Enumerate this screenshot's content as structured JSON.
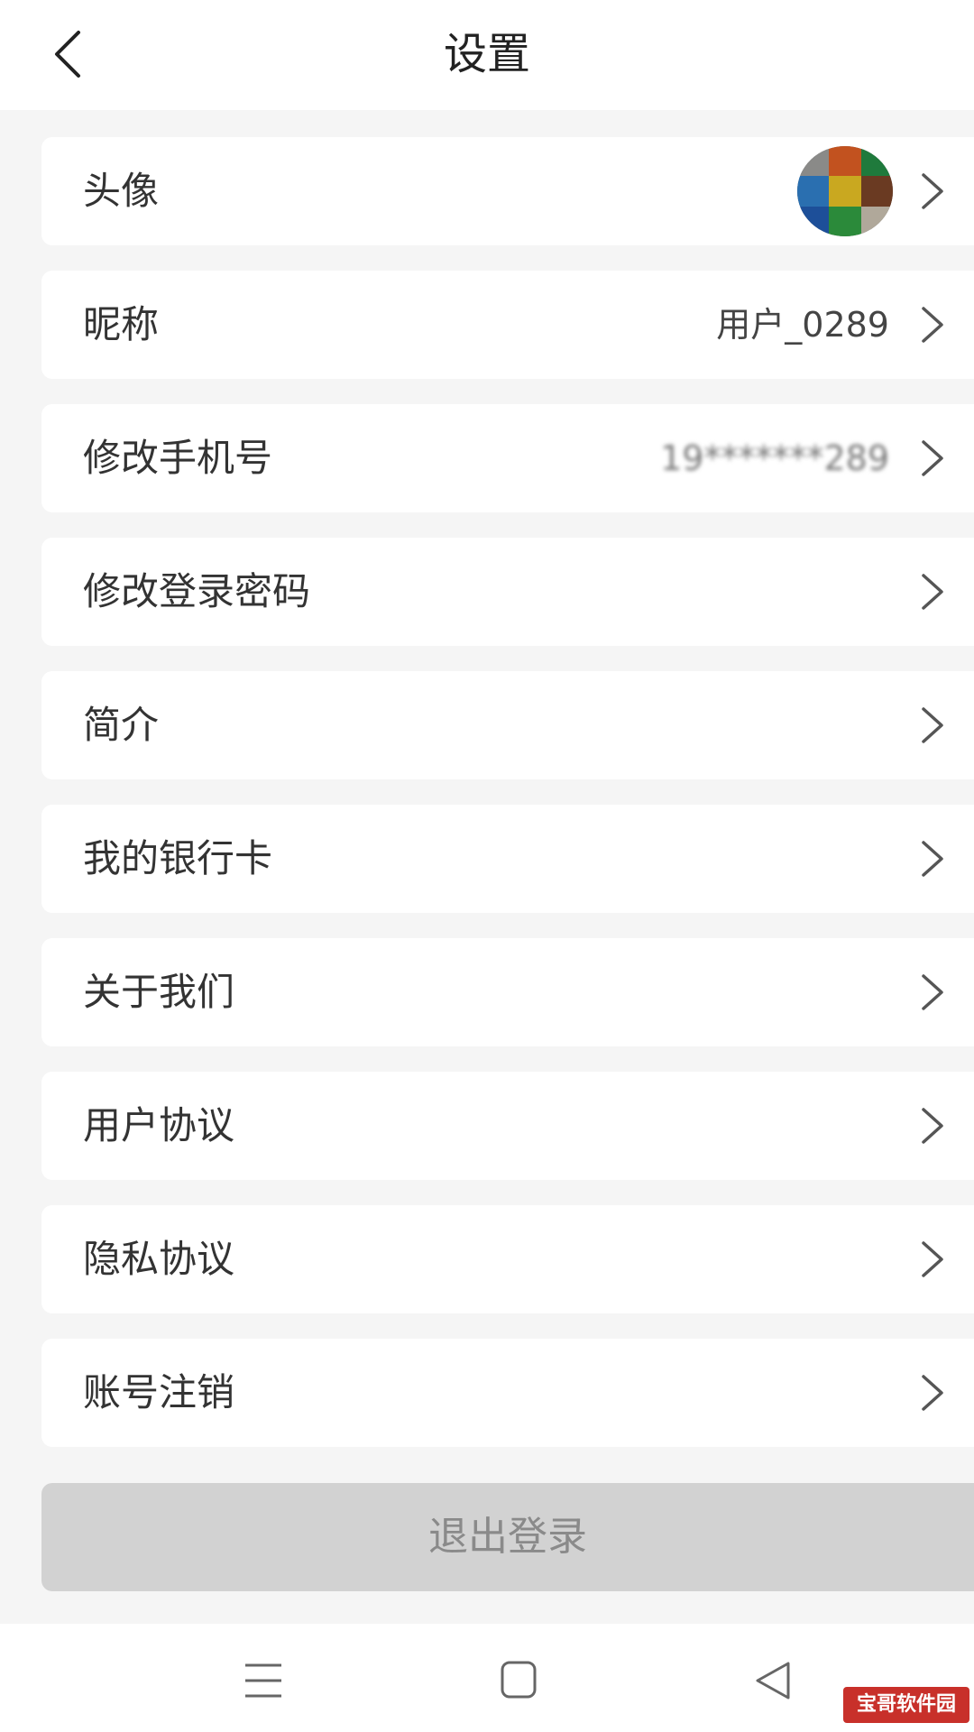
{
  "header": {
    "title": "设置",
    "back_icon": "chevron-left-icon"
  },
  "settings": {
    "avatar": {
      "label": "头像"
    },
    "nickname": {
      "label": "昵称",
      "value": "用户_0289"
    },
    "phone": {
      "label": "修改手机号",
      "value": "19*******289"
    },
    "password": {
      "label": "修改登录密码"
    },
    "intro": {
      "label": "简介"
    },
    "bank_card": {
      "label": "我的银行卡"
    },
    "about": {
      "label": "关于我们"
    },
    "user_agreement": {
      "label": "用户协议"
    },
    "privacy": {
      "label": "隐私协议"
    },
    "delete_account": {
      "label": "账号注销"
    }
  },
  "logout": {
    "label": "退出登录"
  },
  "system_nav": {
    "menu_icon": "menu-icon",
    "home_icon": "home-square-icon",
    "back_icon": "back-triangle-icon"
  },
  "watermark": {
    "text": "宝哥软件园"
  },
  "colors": {
    "background": "#f5f5f5",
    "card": "#ffffff",
    "logout_bg": "#d2d2d2",
    "logout_text": "#8a8a8a",
    "watermark_bg": "#c8302a"
  }
}
